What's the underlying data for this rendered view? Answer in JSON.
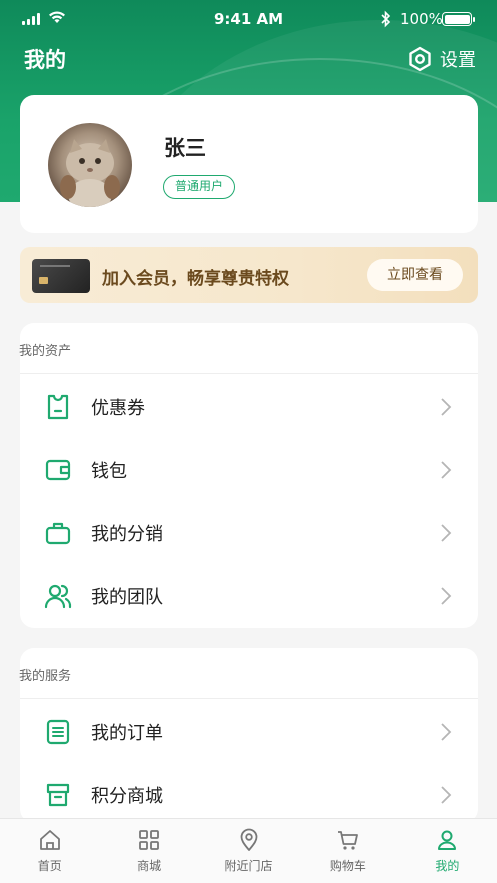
{
  "status": {
    "time": "9:41 AM",
    "battery_pct": "100%"
  },
  "header": {
    "title": "我的",
    "settings_label": "设置"
  },
  "profile": {
    "name": "张三",
    "role_badge": "普通用户"
  },
  "vip": {
    "text": "加入会员，畅享尊贵特权",
    "button": "立即查看"
  },
  "assets": {
    "heading": "我的资产",
    "items": [
      {
        "label": "优惠券",
        "icon": "coupon-icon"
      },
      {
        "label": "钱包",
        "icon": "wallet-icon"
      },
      {
        "label": "我的分销",
        "icon": "briefcase-icon"
      },
      {
        "label": "我的团队",
        "icon": "team-icon"
      }
    ]
  },
  "services": {
    "heading": "我的服务",
    "items": [
      {
        "label": "我的订单",
        "icon": "order-icon"
      },
      {
        "label": "积分商城",
        "icon": "store-icon"
      }
    ]
  },
  "tabbar": {
    "items": [
      {
        "label": "首页",
        "icon": "home-icon"
      },
      {
        "label": "商城",
        "icon": "grid-icon"
      },
      {
        "label": "附近门店",
        "icon": "location-pin-icon"
      },
      {
        "label": "购物车",
        "icon": "cart-icon"
      },
      {
        "label": "我的",
        "icon": "user-icon"
      }
    ],
    "active": "我的"
  },
  "colors": {
    "accent": "#1fa96f",
    "header_bg": "#0f8a5a",
    "vip_text": "#6b4a1e"
  }
}
